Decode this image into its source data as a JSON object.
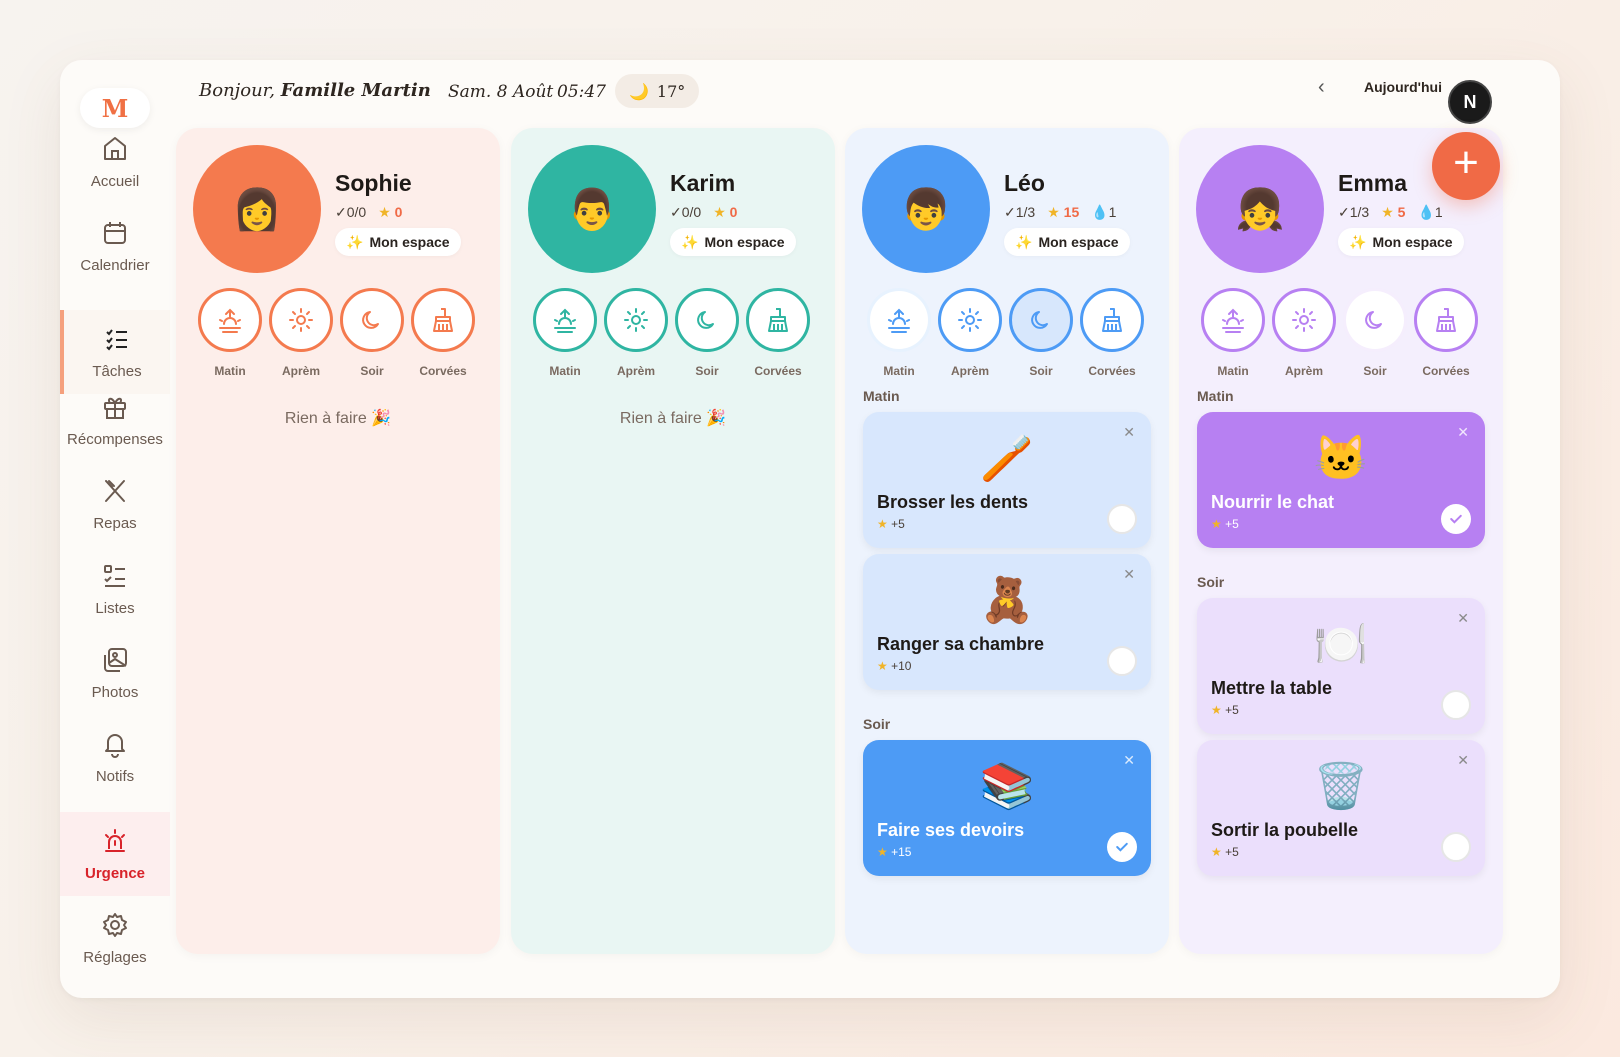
{
  "brand": {
    "logo": "M"
  },
  "sidebar": {
    "items": [
      {
        "label": "Accueil",
        "icon": "home-icon"
      },
      {
        "label": "Calendrier",
        "icon": "calendar-icon"
      },
      {
        "label": "Tâches",
        "icon": "tasks-icon",
        "active": true
      },
      {
        "label": "Récompenses",
        "icon": "gift-icon"
      },
      {
        "label": "Repas",
        "icon": "utensils-icon"
      },
      {
        "label": "Listes",
        "icon": "list-icon"
      },
      {
        "label": "Photos",
        "icon": "photos-icon"
      },
      {
        "label": "Notifs",
        "icon": "bell-icon"
      },
      {
        "label": "Urgence",
        "icon": "siren-icon",
        "urgent": true
      },
      {
        "label": "Réglages",
        "icon": "gear-icon"
      }
    ]
  },
  "header": {
    "greeting_prefix": "Bonjour,",
    "greeting_name": "Famille Martin",
    "date": "Sam. 8 Août",
    "time": "05:47",
    "weather_icon": "🌙",
    "temperature": "17°",
    "today_label": "Aujourd'hui",
    "user_initial": "N",
    "add_label": "+"
  },
  "periods": [
    "Matin",
    "Aprèm",
    "Soir",
    "Corvées"
  ],
  "members": [
    {
      "name": "Sophie",
      "emoji": "👩",
      "color": "#f47a4e",
      "bg": "#fdeeea",
      "done": "✓0/0",
      "points": "0",
      "streak": "",
      "espace": "Mon espace",
      "empty": "Rien à faire 🎉",
      "sections": []
    },
    {
      "name": "Karim",
      "emoji": "👨",
      "color": "#2fb5a2",
      "bg": "#e9f6f3",
      "done": "✓0/0",
      "points": "0",
      "streak": "",
      "espace": "Mon espace",
      "empty": "Rien à faire 🎉",
      "sections": []
    },
    {
      "name": "Léo",
      "emoji": "👦",
      "color": "#4d9bf5",
      "bg": "#edf3fd",
      "done": "✓1/3",
      "points": "15",
      "streak": "💧1",
      "espace": "Mon espace",
      "empty": "",
      "sections": [
        {
          "title": "Matin",
          "tasks": [
            {
              "emoji": "🪥",
              "name": "Brosser les dents",
              "points": "+5",
              "done": false
            },
            {
              "emoji": "🧸",
              "name": "Ranger sa chambre",
              "points": "+10",
              "done": false
            }
          ]
        },
        {
          "title": "Soir",
          "tasks": [
            {
              "emoji": "📚",
              "name": "Faire ses devoirs",
              "points": "+15",
              "done": true
            }
          ]
        }
      ]
    },
    {
      "name": "Emma",
      "emoji": "👧",
      "color": "#b780f2",
      "bg": "#f4effd",
      "done": "✓1/3",
      "points": "5",
      "streak": "💧1",
      "espace": "Mon espace",
      "empty": "",
      "sections": [
        {
          "title": "Matin",
          "tasks": [
            {
              "emoji": "🐱",
              "name": "Nourrir le chat",
              "points": "+5",
              "done": true
            }
          ]
        },
        {
          "title": "Soir",
          "tasks": [
            {
              "emoji": "🍽️",
              "name": "Mettre la table",
              "points": "+5",
              "done": false
            },
            {
              "emoji": "🗑️",
              "name": "Sortir la poubelle",
              "points": "+5",
              "done": false
            }
          ]
        }
      ]
    }
  ]
}
